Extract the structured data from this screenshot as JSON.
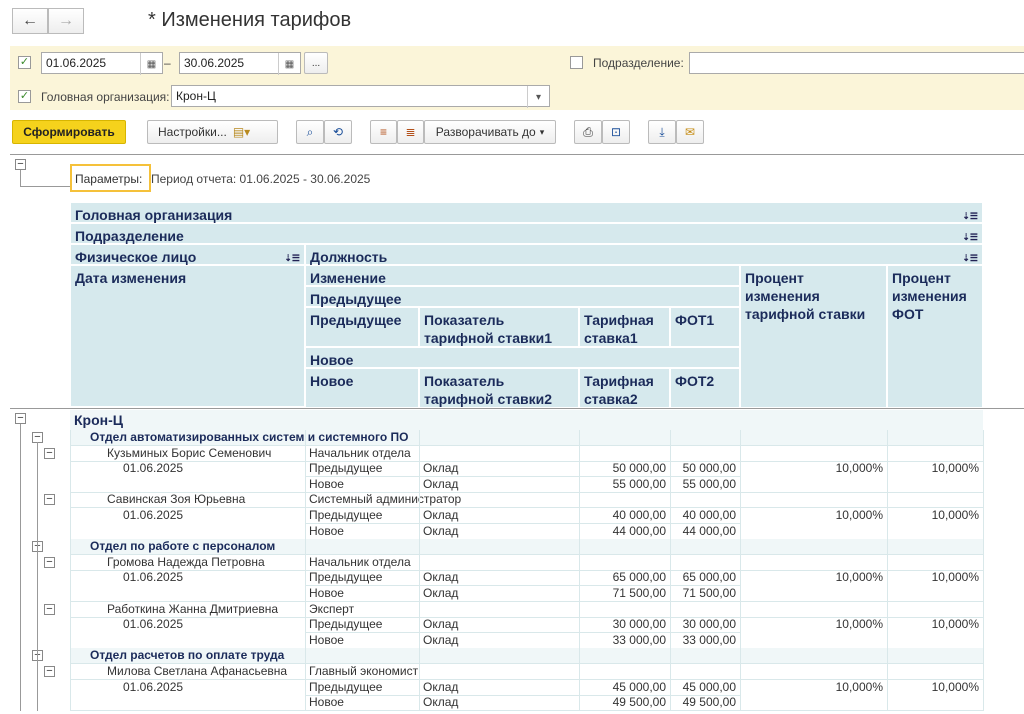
{
  "window": {
    "title": "* Изменения тарифов",
    "back_icon": "←",
    "forward_icon": "→"
  },
  "filters": {
    "date_from": "01.06.2025",
    "date_to": "30.06.2025",
    "dash": "–",
    "ellipsis": "...",
    "division_label": "Подразделение:",
    "division_value": "",
    "org_label": "Головная организация:",
    "org_value": "Крон-Ц"
  },
  "toolbar": {
    "generate": "Сформировать",
    "settings": "Настройки...",
    "expand": "Разворачивать до"
  },
  "params": {
    "label": "Параметры:",
    "text": "Период отчета: 01.06.2025 - 30.06.2025"
  },
  "header": {
    "org": "Головная организация",
    "division": "Подразделение",
    "person": "Физическое лицо",
    "position": "Должность",
    "change_date": "Дата изменения",
    "change": "Изменение",
    "previous_group": "Предыдущее",
    "previous": "Предыдущее",
    "indicator1": "Показатель тарифной ставки1",
    "rate1": "Тарифная ставка1",
    "fot1": "ФОТ1",
    "new_group": "Новое",
    "new": "Новое",
    "indicator2": "Показатель тарифной ставки2",
    "rate2": "Тарифная ставка2",
    "fot2": "ФОТ2",
    "pct_rate": "Процент изменения тарифной ставки",
    "pct_fot": "Процент изменения ФОТ"
  },
  "org_name": "Крон-Ц",
  "groups": [
    {
      "name": "Отдел автоматизированных систем и системного ПО",
      "people": [
        {
          "name": "Кузьминых Борис Семенович",
          "position": "Начальник отдела",
          "date": "01.06.2025",
          "prev_label": "Предыдущее",
          "new_label": "Новое",
          "indicator": "Оклад",
          "prev_rate": "50 000,00",
          "prev_fot": "50 000,00",
          "new_rate": "55 000,00",
          "new_fot": "55 000,00",
          "pct_rate": "10,000%",
          "pct_fot": "10,000%"
        },
        {
          "name": "Савинская Зоя Юрьевна",
          "position": "Системный администратор",
          "date": "01.06.2025",
          "prev_label": "Предыдущее",
          "new_label": "Новое",
          "indicator": "Оклад",
          "prev_rate": "40 000,00",
          "prev_fot": "40 000,00",
          "new_rate": "44 000,00",
          "new_fot": "44 000,00",
          "pct_rate": "10,000%",
          "pct_fot": "10,000%"
        }
      ]
    },
    {
      "name": "Отдел по работе с персоналом",
      "people": [
        {
          "name": "Громова Надежда Петровна",
          "position": "Начальник отдела",
          "date": "01.06.2025",
          "prev_label": "Предыдущее",
          "new_label": "Новое",
          "indicator": "Оклад",
          "prev_rate": "65 000,00",
          "prev_fot": "65 000,00",
          "new_rate": "71 500,00",
          "new_fot": "71 500,00",
          "pct_rate": "10,000%",
          "pct_fot": "10,000%"
        },
        {
          "name": "Работкина Жанна Дмитриевна",
          "position": "Эксперт",
          "date": "01.06.2025",
          "prev_label": "Предыдущее",
          "new_label": "Новое",
          "indicator": "Оклад",
          "prev_rate": "30 000,00",
          "prev_fot": "30 000,00",
          "new_rate": "33 000,00",
          "new_fot": "33 000,00",
          "pct_rate": "10,000%",
          "pct_fot": "10,000%"
        }
      ]
    },
    {
      "name": "Отдел расчетов по оплате труда",
      "people": [
        {
          "name": "Милова Светлана Афанасьевна",
          "position": "Главный экономист",
          "date": "01.06.2025",
          "prev_label": "Предыдущее",
          "new_label": "Новое",
          "indicator": "Оклад",
          "prev_rate": "45 000,00",
          "prev_fot": "45 000,00",
          "new_rate": "49 500,00",
          "new_fot": "49 500,00",
          "pct_rate": "10,000%",
          "pct_fot": "10,000%"
        }
      ]
    }
  ]
}
